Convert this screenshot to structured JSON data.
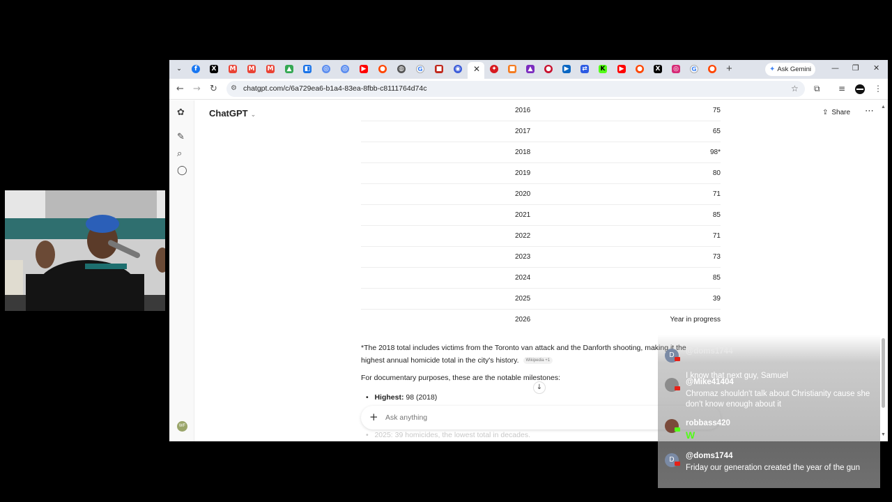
{
  "browser": {
    "url": "chatgpt.com/c/6a729ea6-b1a4-83ea-8fbb-c8111764d74c",
    "ask_gemini": "Ask Gemini"
  },
  "app": {
    "title": "ChatGPT",
    "share_label": "Share",
    "avatar_initials": "WF"
  },
  "table": {
    "rows": [
      {
        "year": "2016",
        "value": "75"
      },
      {
        "year": "2017",
        "value": "65"
      },
      {
        "year": "2018",
        "value": "98*"
      },
      {
        "year": "2019",
        "value": "80"
      },
      {
        "year": "2020",
        "value": "71"
      },
      {
        "year": "2021",
        "value": "85"
      },
      {
        "year": "2022",
        "value": "71"
      },
      {
        "year": "2023",
        "value": "73"
      },
      {
        "year": "2024",
        "value": "85"
      },
      {
        "year": "2025",
        "value": "39"
      },
      {
        "year": "2026",
        "value": "Year in progress"
      }
    ]
  },
  "content": {
    "footnote": "*The 2018 total includes victims from the Toronto van attack and the Danforth shooting, making it the highest annual homicide total in the city's history.",
    "citation": "Wikipedia +1",
    "milestones_intro": "For documentary purposes, these are the notable milestones:",
    "bullet1_label": "Highest:",
    "bullet1_value": " 98 (2018)",
    "bullet2": "2025: 39 homicides, the lowest total in decades."
  },
  "composer": {
    "placeholder": "Ask anything"
  },
  "chat": {
    "messages": [
      {
        "user": "@doms1744",
        "text": "I know that next guy, Samuel",
        "initial": "D"
      },
      {
        "user": "@Mike41404",
        "text": "Chromaz shouldn't talk about Christianity cause she don't know enough about it",
        "initial": ""
      },
      {
        "user": "robbass420",
        "text": "W",
        "initial": ""
      },
      {
        "user": "@doms1744",
        "text": "Friday our generation created the year of the gun",
        "initial": "D"
      }
    ]
  },
  "colors": {
    "tabbar": "#dfe3eb",
    "chat_accent": "#e62117"
  }
}
